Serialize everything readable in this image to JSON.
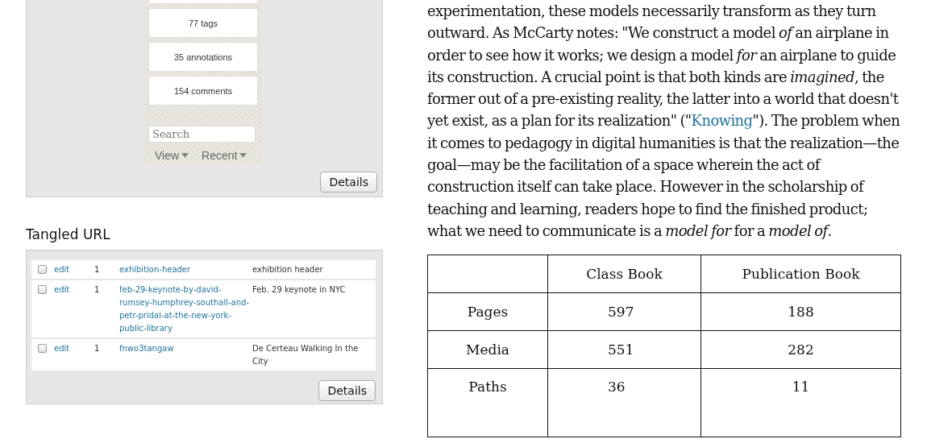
{
  "sidebar": {
    "stats": [
      "77 tags",
      "35 annotations",
      "154 comments"
    ],
    "search": {
      "placeholder": "Search"
    },
    "menus": [
      "View",
      "Recent"
    ],
    "button": "Details"
  },
  "tangled_url": {
    "title": "Tangled URL",
    "rows": [
      {
        "checked": false,
        "action": "edit",
        "count": "1",
        "slug": "exhibition-header",
        "name": "exhibition header"
      },
      {
        "checked": false,
        "action": "edit",
        "count": "1",
        "slug": "feb-29-keynote-by-david-rumsey-humphrey-southall-and-petr-pridal-at-the-new-york-public-library",
        "name": "Feb. 29 keynote in NYC"
      },
      {
        "checked": false,
        "action": "edit",
        "count": "1",
        "slug": "fnwo3tangaw",
        "name": "De Certeau Walking In the City"
      }
    ],
    "button": "Details"
  },
  "essay": {
    "before": "experimentation, these models necessarily transform as they turn outward. As McCarty notes: \"We construct a model *of* an airplane in order to see how it works; we design a model *for* an airplane to guide its construction. A crucial point is that both kinds are *imagined*, the former out of a pre-existing reality, the latter into a world that doesn't yet exist, as a plan for its realization\" (\"",
    "link": "Knowing",
    "after": "\"). The problem when it comes to pedagogy in digital humanities is that the realization—the goal—may be the facilitation of a space wherein the act of construction itself can take place. However in the scholarship of teaching and learning, readers hope to find the finished product; what we need to communicate is a *model for* for a *model of*."
  },
  "table": {
    "columns": [
      "Class Book",
      "Publication Book"
    ],
    "rows": [
      {
        "label": "Pages",
        "values": [
          "597",
          "188"
        ]
      },
      {
        "label": "Media",
        "values": [
          "551",
          "282"
        ]
      },
      {
        "label": "Paths",
        "values": [
          "36",
          "11"
        ]
      }
    ]
  }
}
